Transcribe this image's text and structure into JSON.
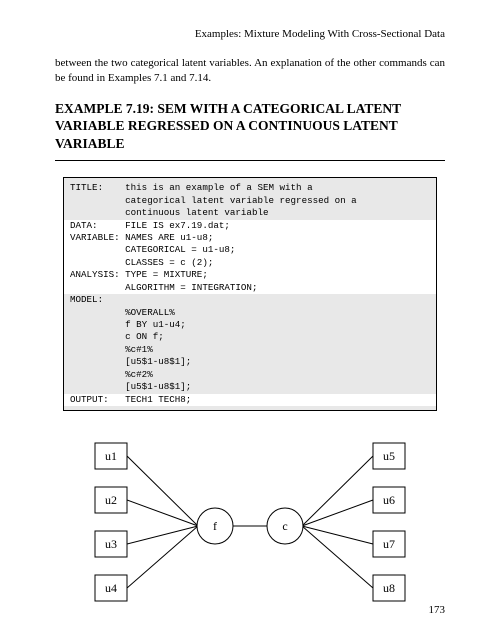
{
  "runningHeader": "Examples: Mixture Modeling With Cross-Sectional Data",
  "introParagraph": "between the two categorical latent variables.  An explanation of the other commands can be found in Examples 7.1 and 7.14.",
  "sectionHeading": "EXAMPLE 7.19: SEM WITH A CATEGORICAL LATENT VARIABLE REGRESSED ON A CONTINUOUS LATENT VARIABLE",
  "code": {
    "segments": [
      {
        "bg": "grey",
        "text": "TITLE:    this is an example of a SEM with a\n          categorical latent variable regressed on a\n          continuous latent variable"
      },
      {
        "bg": "white",
        "text": "DATA:     FILE IS ex7.19.dat;\nVARIABLE: NAMES ARE u1-u8;\n          CATEGORICAL = u1-u8;\n          CLASSES = c (2);\nANALYSIS: TYPE = MIXTURE;\n          ALGORITHM = INTEGRATION;"
      },
      {
        "bg": "grey",
        "text": "MODEL:\n          %OVERALL%\n          f BY u1-u4;\n          c ON f;\n          %c#1%\n          [u5$1-u8$1];\n          %c#2%\n          [u5$1-u8$1];"
      },
      {
        "bg": "white",
        "text": "OUTPUT:   TECH1 TECH8;"
      }
    ]
  },
  "diagram": {
    "leftBoxes": [
      "u1",
      "u2",
      "u3",
      "u4"
    ],
    "rightBoxes": [
      "u5",
      "u6",
      "u7",
      "u8"
    ],
    "circleLeft": "f",
    "circleRight": "c"
  },
  "pageNumber": "173"
}
